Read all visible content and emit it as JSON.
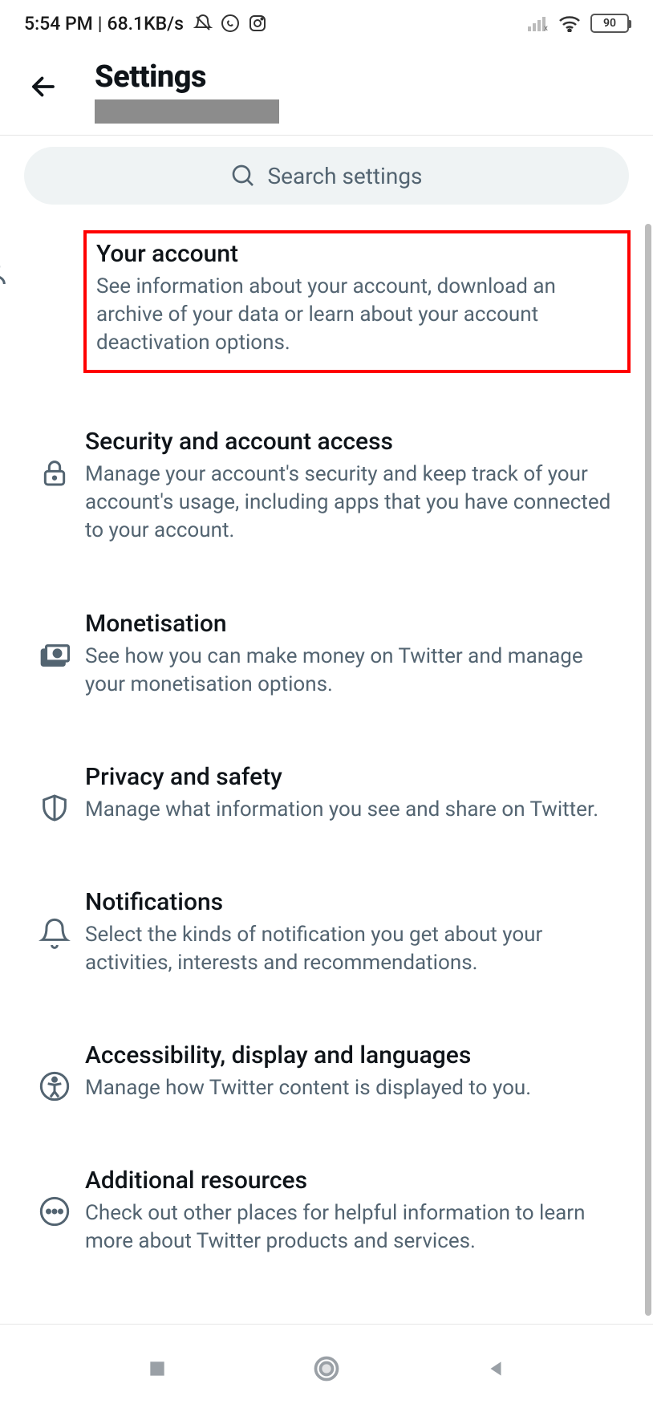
{
  "status": {
    "time": "5:54 PM",
    "sep": "|",
    "net_speed": "68.1KB/s",
    "battery_pct": "90"
  },
  "header": {
    "title": "Settings"
  },
  "search": {
    "placeholder": "Search settings"
  },
  "items": [
    {
      "icon": "person-icon",
      "title": "Your account",
      "desc": "See information about your account, download an archive of your data or learn about your account deactivation options."
    },
    {
      "icon": "lock-icon",
      "title": "Security and account access",
      "desc": "Manage your account's security and keep track of your account's usage, including apps that you have connected to your account."
    },
    {
      "icon": "money-icon",
      "title": "Monetisation",
      "desc": "See how you can make money on Twitter and manage your monetisation options."
    },
    {
      "icon": "shield-icon",
      "title": "Privacy and safety",
      "desc": "Manage what information you see and share on Twitter."
    },
    {
      "icon": "bell-icon",
      "title": "Notifications",
      "desc": "Select the kinds of notification you get about your activities, interests and recommendations."
    },
    {
      "icon": "accessibility-icon",
      "title": "Accessibility, display and languages",
      "desc": "Manage how Twitter content is displayed to you."
    },
    {
      "icon": "dots-icon",
      "title": "Additional resources",
      "desc": "Check out other places for helpful information to learn more about Twitter products and services."
    }
  ]
}
